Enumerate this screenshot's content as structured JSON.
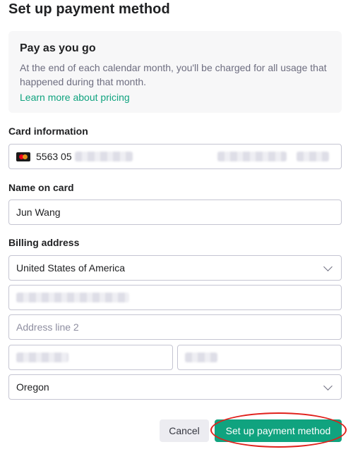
{
  "page": {
    "title": "Set up payment method"
  },
  "plan": {
    "title": "Pay as you go",
    "description": "At the end of each calendar month, you'll be charged for all usage that happened during that month.",
    "link": "Learn more about pricing"
  },
  "card": {
    "label": "Card information",
    "number_prefix": "5563 05",
    "icon": "mastercard-icon"
  },
  "name": {
    "label": "Name on card",
    "value": "Jun Wang"
  },
  "billing": {
    "label": "Billing address",
    "country": "United States of America",
    "address_line2_placeholder": "Address line 2",
    "state": "Oregon"
  },
  "actions": {
    "cancel": "Cancel",
    "submit": "Set up payment method"
  },
  "colors": {
    "accent": "#10a37f",
    "annotation": "#e0201b"
  }
}
